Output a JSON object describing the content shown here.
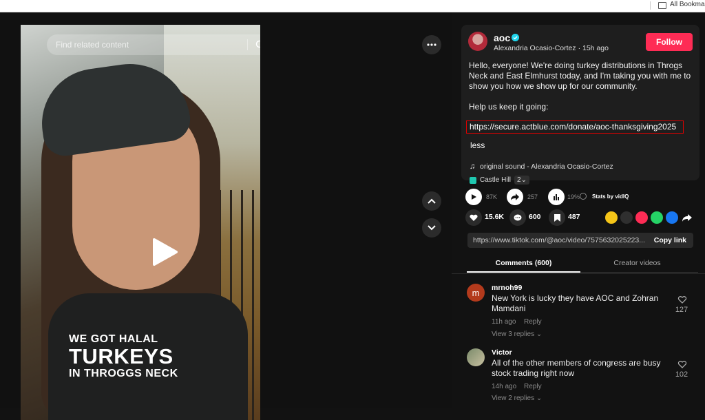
{
  "browser": {
    "bookmarks_label": "All Bookmarks"
  },
  "video": {
    "search_placeholder": "Find related content",
    "overlay": {
      "line1": "WE GOT HALAL",
      "line2": "TURKEYS",
      "line3": "IN THROGGS NECK"
    }
  },
  "post": {
    "username": "aoc",
    "display_name": "Alexandria Ocasio-Cortez",
    "time": "15h ago",
    "follow_label": "Follow",
    "description": "Hello, everyone! We're doing turkey distributions in Throgs Neck and East Elmhurst today, and I'm taking you with me to show you how we show up for our community.",
    "help_text": "Help us keep it going:",
    "link": "https://secure.actblue.com/donate/aoc-thanksgiving2025",
    "less_label": "less",
    "sound": "original sound - Alexandria Ocasio-Cortez",
    "location": "Castle Hill",
    "location_count": "2"
  },
  "stats": {
    "plays": "87K",
    "shares": "257",
    "pct": "19%",
    "stats_label": "Stats by vidIQ"
  },
  "actions": {
    "likes": "15.6K",
    "comments": "600",
    "saves": "487"
  },
  "share_link": {
    "url": "https://www.tiktok.com/@aoc/video/7575632025223...",
    "copy_label": "Copy link"
  },
  "tabs": {
    "comments": "Comments (600)",
    "creator": "Creator videos"
  },
  "comments": [
    {
      "avatar_letter": "m",
      "user": "mrnoh99",
      "text": "New York is lucky they have AOC and Zohran Mamdani",
      "time": "11h ago",
      "reply": "Reply",
      "replies": "View 3 replies",
      "likes": "127"
    },
    {
      "avatar_letter": "",
      "user": "Victor",
      "text": "All of the other members of congress are busy stock trading right now",
      "time": "14h ago",
      "reply": "Reply",
      "replies": "View 2 replies",
      "likes": "102"
    }
  ],
  "colors": {
    "follow": "#fe2c55",
    "highlight_box": "#e00000",
    "verified": "#20d5ec"
  }
}
